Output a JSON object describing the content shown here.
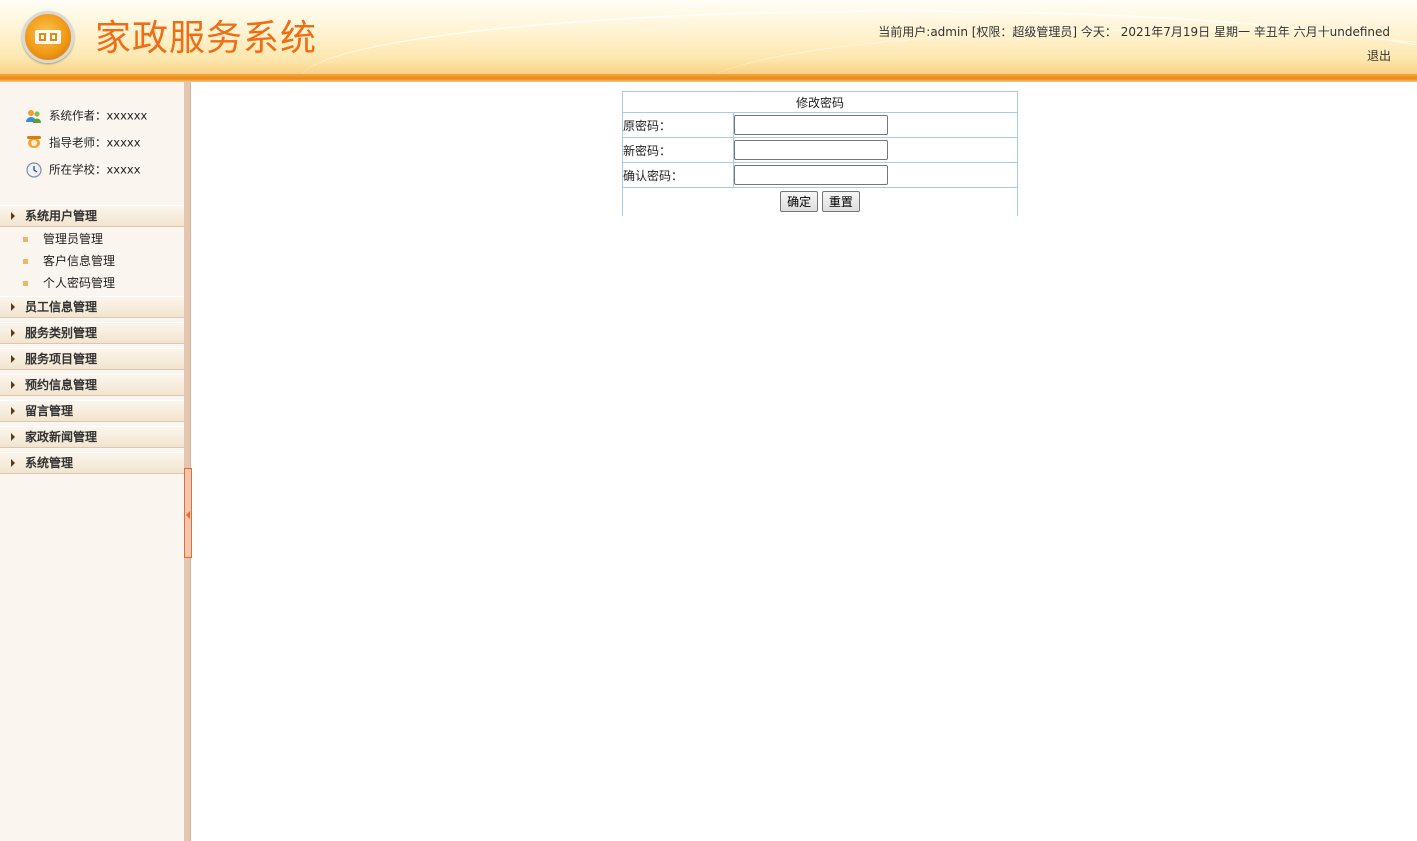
{
  "header": {
    "title": "家政服务系统",
    "user_info": "当前用户:admin [权限：超级管理员] 今天： 2021年7月19日 星期一 辛丑年 六月十undefined",
    "logout": "退出",
    "logo_icon": "gold-coin-logo-icon"
  },
  "sidebar": {
    "info": [
      {
        "icon": "users-icon",
        "label": "系统作者：xxxxxx"
      },
      {
        "icon": "teacher-icon",
        "label": "指导老师：xxxxx"
      },
      {
        "icon": "clock-icon",
        "label": "所在学校：xxxxx"
      }
    ],
    "menus": [
      {
        "label": "系统用户管理",
        "expanded": true,
        "items": [
          "管理员管理",
          "客户信息管理",
          "个人密码管理"
        ]
      },
      {
        "label": "员工信息管理"
      },
      {
        "label": "服务类别管理"
      },
      {
        "label": "服务项目管理"
      },
      {
        "label": "预约信息管理"
      },
      {
        "label": "留言管理"
      },
      {
        "label": "家政新闻管理"
      },
      {
        "label": "系统管理"
      }
    ]
  },
  "form": {
    "caption": "修改密码",
    "old_label": "原密码：",
    "old_value": "",
    "new_label": "新密码：",
    "new_value": "",
    "confirm_label": "确认密码：",
    "confirm_value": "",
    "submit": "确定",
    "reset": "重置"
  },
  "colors": {
    "title": "#ef6d13",
    "header_band": "#e98a14",
    "sidebar_bg": "#fbf5f0",
    "table_border": "#a8cbe6"
  }
}
